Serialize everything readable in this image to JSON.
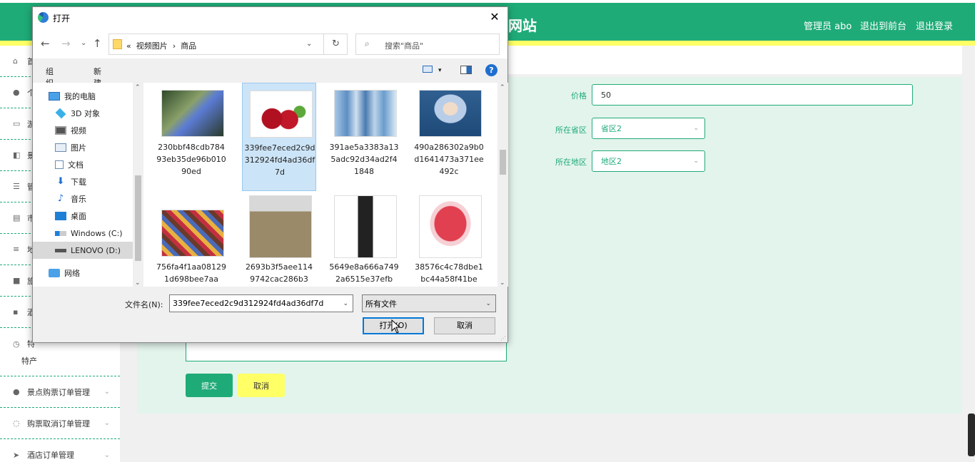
{
  "header": {
    "site_title": "网站",
    "admin_label": "管理员 abo",
    "back_to_front": "退出到前台",
    "logout": "退出登录"
  },
  "sidebar": {
    "items": [
      {
        "label": "首"
      },
      {
        "label": "个"
      },
      {
        "label": "游"
      },
      {
        "label": "景"
      },
      {
        "label": "管"
      },
      {
        "label": "市"
      },
      {
        "label": "地"
      },
      {
        "label": "旅"
      },
      {
        "label": "酒"
      },
      {
        "label": "特"
      },
      {
        "label": "特产"
      },
      {
        "label": "景点购票订单管理"
      },
      {
        "label": "购票取消订单管理"
      },
      {
        "label": "酒店订单管理"
      }
    ]
  },
  "form": {
    "price_label": "价格",
    "price_value": "50",
    "province_label": "所在省区",
    "province_value": "省区2",
    "region_label": "所在地区",
    "region_value": "地区2",
    "submit_label": "提交",
    "cancel_label": "取消"
  },
  "dialog": {
    "title": "打开",
    "close": "✕",
    "address_prefix": "«",
    "address_path": [
      "视频图片",
      "商品"
    ],
    "search_placeholder": "搜索\"商品\"",
    "organize_label": "组织 ▾",
    "new_folder_label": "新建文件夹",
    "help": "?",
    "nav_items": [
      {
        "label": "我的电脑"
      },
      {
        "label": "3D 对象"
      },
      {
        "label": "视频"
      },
      {
        "label": "图片"
      },
      {
        "label": "文档"
      },
      {
        "label": "下载"
      },
      {
        "label": "音乐"
      },
      {
        "label": "桌面"
      },
      {
        "label": "Windows (C:)"
      },
      {
        "label": "LENOVO (D:)"
      },
      {
        "label": "网络"
      }
    ],
    "files": [
      {
        "name": "230bbf48cdb78493eb35de96b01090ed",
        "thumb": "phone-image"
      },
      {
        "name": "339fee7eced2c9d312924fd4ad36df7d",
        "thumb": "cherry-image"
      },
      {
        "name": "391ae5a3383a135adc92d34ad2f41848",
        "thumb": "cosmetics-image"
      },
      {
        "name": "490a286302a9b0d1641473a371ee492c",
        "thumb": "model-image"
      },
      {
        "name": "756fa4f1aa081291d698bee7aa",
        "thumb": "snacks-image"
      },
      {
        "name": "2693b3f5aee1149742cac286b3",
        "thumb": "calculator-image"
      },
      {
        "name": "5649e8a666a7492a6515e37efb",
        "thumb": "tube-image"
      },
      {
        "name": "38576c4c78dbe1bc44a58f41be",
        "thumb": "cart-image"
      }
    ],
    "filename_label": "文件名(N):",
    "filename_value": "339fee7eced2c9d312924fd4ad36df7d",
    "filter_value": "所有文件",
    "open_label": "打开(O)",
    "cancel_label": "取消"
  }
}
